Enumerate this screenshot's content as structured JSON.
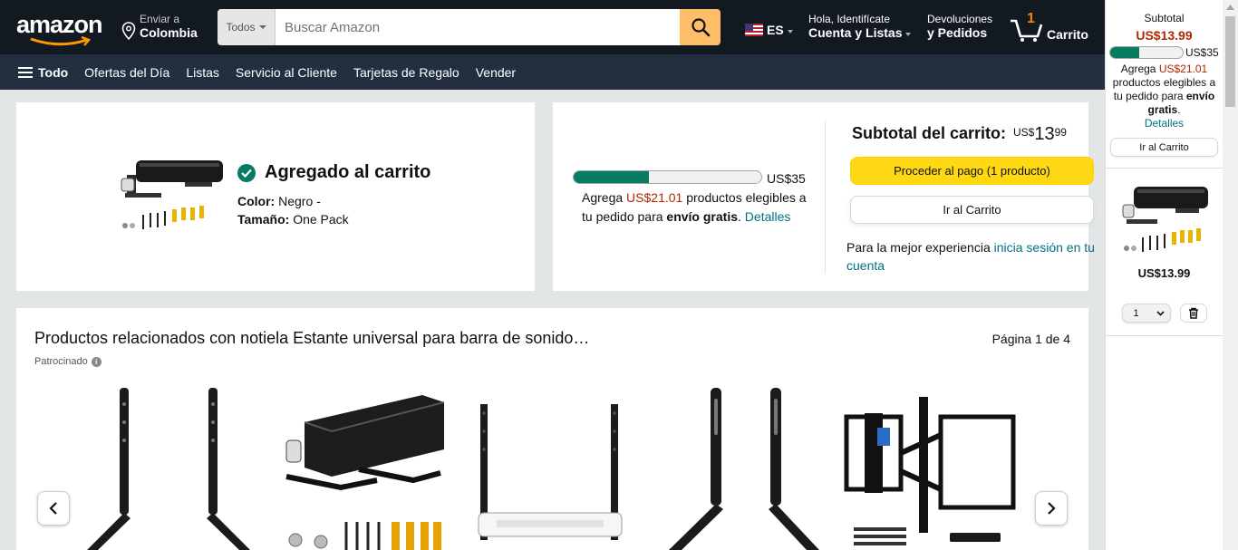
{
  "header": {
    "logo": "amazon",
    "deliver_line1": "Enviar a",
    "deliver_line2": "Colombia",
    "search_category": "Todos",
    "search_placeholder": "Buscar Amazon",
    "language": "ES",
    "account_line1": "Hola, Identifícate",
    "account_line2": "Cuenta y Listas",
    "returns_line1": "Devoluciones",
    "returns_line2": "y Pedidos",
    "cart_count": "1",
    "cart_label": "Carrito"
  },
  "subnav": {
    "all": "Todo",
    "items": [
      "Ofertas del Día",
      "Listas",
      "Servicio al Cliente",
      "Tarjetas de Regalo",
      "Vender"
    ]
  },
  "added": {
    "title": "Agregado al carrito",
    "color_label": "Color:",
    "color_value": "Negro -",
    "size_label": "Tamaño:",
    "size_value": "One Pack"
  },
  "subtotal": {
    "threshold": "US$35",
    "progress_fraction": 0.4,
    "add_prefix": "Agrega",
    "add_amount": "US$21.01",
    "add_suffix": "productos elegibles a tu pedido para",
    "free_shipping": "envío gratis",
    "details": "Detalles",
    "heading": "Subtotal del carrito:",
    "price_currency": "US$",
    "price_whole": "13",
    "price_fraction": "99",
    "checkout_button": "Proceder al pago (1 producto)",
    "cart_button": "Ir al Carrito",
    "signin_prefix": "Para la mejor experiencia",
    "signin_link": "inicia sesión en tu cuenta"
  },
  "related": {
    "title": "Productos relacionados con notiela Estante universal para barra de sonido…",
    "page": "Página 1 de 4",
    "sponsored": "Patrocinado"
  },
  "flyout": {
    "subtotal_label": "Subtotal",
    "subtotal_price": "US$13.99",
    "threshold": "US$35",
    "note_prefix": "Agrega",
    "note_amount": "US$21.01",
    "note_mid": "productos elegibles a tu pedido para",
    "note_bold": "envío gratis",
    "details": "Detalles",
    "cart_button": "Ir al Carrito",
    "item_price": "US$13.99",
    "qty": "1"
  },
  "colors": {
    "header_bg": "#131921",
    "subnav_bg": "#232f3e",
    "search_button": "#febd69",
    "checkout_yellow": "#ffd814",
    "progress_green": "#067d62",
    "price_red": "#b12704",
    "link_teal": "#007185"
  }
}
